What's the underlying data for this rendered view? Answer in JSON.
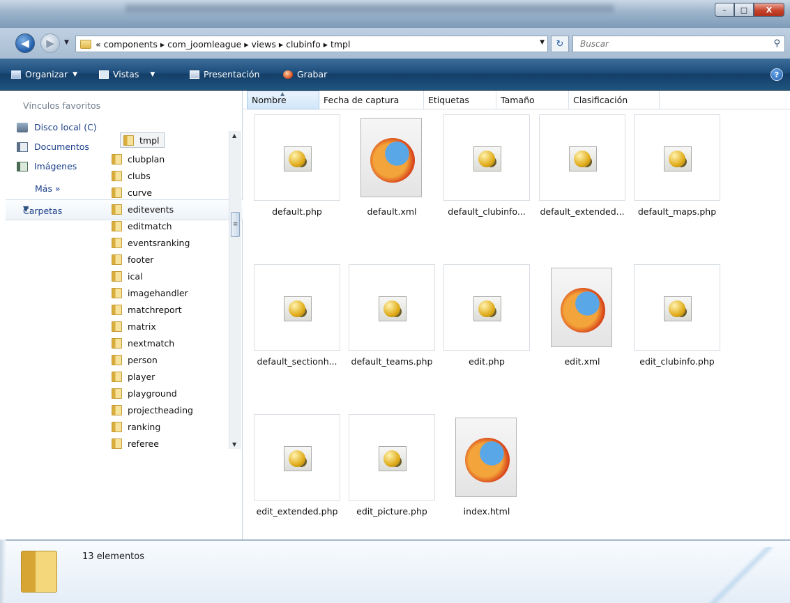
{
  "window": {
    "min_glyph": "–",
    "max_glyph": "□",
    "close_glyph": "X"
  },
  "address": {
    "back_glyph": "◀",
    "forward_glyph": "▶",
    "crumbs": "« components ▸ com_joomleague ▸ views ▸ clubinfo ▸ tmpl",
    "search_placeholder": "Buscar"
  },
  "toolbar": {
    "organize": "Organizar",
    "views": "Vistas",
    "presentation": "Presentación",
    "burn": "Grabar"
  },
  "nav": {
    "favorites_header": "Vínculos favoritos",
    "favorites": [
      {
        "label": "Disco local (C)"
      },
      {
        "label": "Documentos"
      },
      {
        "label": "Imágenes"
      }
    ],
    "more": "Más »",
    "folders_header": "Carpetas",
    "tree": [
      "tmpl",
      "clubplan",
      "clubs",
      "curve",
      "editevents",
      "editmatch",
      "eventsranking",
      "footer",
      "ical",
      "imagehandler",
      "matchreport",
      "matrix",
      "nextmatch",
      "person",
      "player",
      "playground",
      "projectheading",
      "ranking",
      "referee"
    ]
  },
  "columns": [
    "Nombre",
    "Fecha de captura",
    "Etiquetas",
    "Tamaño",
    "Clasificación"
  ],
  "files": [
    {
      "name": "default.php",
      "type": "php"
    },
    {
      "name": "default.xml",
      "type": "xml"
    },
    {
      "name": "default_clubinfo...",
      "type": "php"
    },
    {
      "name": "default_extended...",
      "type": "php"
    },
    {
      "name": "default_maps.php",
      "type": "php"
    },
    {
      "name": "default_sectionh...",
      "type": "php"
    },
    {
      "name": "default_teams.php",
      "type": "php"
    },
    {
      "name": "edit.php",
      "type": "php"
    },
    {
      "name": "edit.xml",
      "type": "xml"
    },
    {
      "name": "edit_clubinfo.php",
      "type": "php"
    },
    {
      "name": "edit_extended.php",
      "type": "php"
    },
    {
      "name": "edit_picture.php",
      "type": "php"
    },
    {
      "name": "index.html",
      "type": "xml"
    }
  ],
  "status": {
    "count": "13 elementos"
  }
}
